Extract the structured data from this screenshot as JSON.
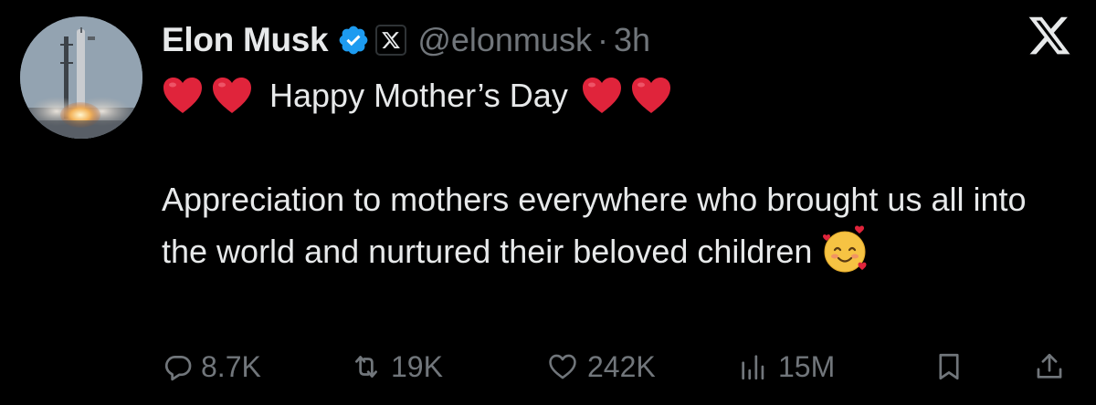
{
  "author": {
    "name": "Elon Musk",
    "handle": "@elonmusk",
    "separator": "·",
    "time": "3h",
    "verified_color": "#1d9bf0"
  },
  "tweet": {
    "headline": "Happy Mother’s Day",
    "body": "Appreciation to mothers everywhere who brought us all into the world and nurtured their beloved children",
    "emojis": [
      "red-heart",
      "red-heart",
      "red-heart",
      "red-heart",
      "smiling-face-with-hearts"
    ]
  },
  "actions": {
    "replies": "8.7K",
    "reposts": "19K",
    "likes": "242K",
    "views": "15M"
  },
  "colors": {
    "background": "#000000",
    "text": "#e7e9ea",
    "muted": "#71767b",
    "heart": "#e0243b"
  }
}
